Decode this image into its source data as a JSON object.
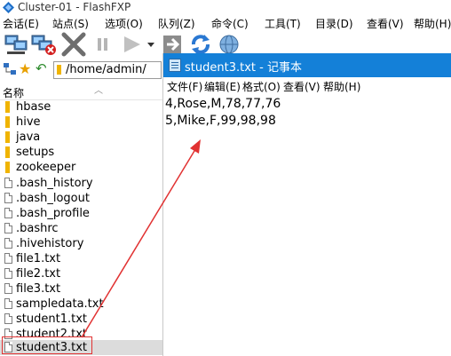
{
  "window": {
    "title": "Cluster-01 - FlashFXP"
  },
  "menu": [
    "会话(E)",
    "站点(S)",
    "选项(O)",
    "队列(Z)",
    "命令(C)",
    "工具(T)",
    "目录(D)",
    "查看(V)",
    "帮助(H)"
  ],
  "path": {
    "value": "/home/admin/"
  },
  "filelist": {
    "column_name": "名称",
    "items": [
      {
        "name": "hbase",
        "type": "folder"
      },
      {
        "name": "hive",
        "type": "folder"
      },
      {
        "name": "java",
        "type": "folder"
      },
      {
        "name": "setups",
        "type": "folder"
      },
      {
        "name": "zookeeper",
        "type": "folder"
      },
      {
        "name": ".bash_history",
        "type": "file"
      },
      {
        "name": ".bash_logout",
        "type": "file"
      },
      {
        "name": ".bash_profile",
        "type": "file"
      },
      {
        "name": ".bashrc",
        "type": "file"
      },
      {
        "name": ".hivehistory",
        "type": "file"
      },
      {
        "name": "file1.txt",
        "type": "file"
      },
      {
        "name": "file2.txt",
        "type": "file"
      },
      {
        "name": "file3.txt",
        "type": "file"
      },
      {
        "name": "sampledata.txt",
        "type": "file"
      },
      {
        "name": "student1.txt",
        "type": "file"
      },
      {
        "name": "student2.txt",
        "type": "file"
      },
      {
        "name": "student3.txt",
        "type": "file"
      }
    ]
  },
  "notepad": {
    "title": "student3.txt - 记事本",
    "menu": [
      "文件(F)",
      "编辑(E)",
      "格式(O)",
      "查看(V)",
      "帮助(H)"
    ],
    "lines": [
      "4,Rose,M,78,77,76",
      "5,Mike,F,99,98,98"
    ]
  },
  "colors": {
    "notepad_title": "#1480d8",
    "highlight": "#e13232",
    "folder": "#f0b400"
  }
}
